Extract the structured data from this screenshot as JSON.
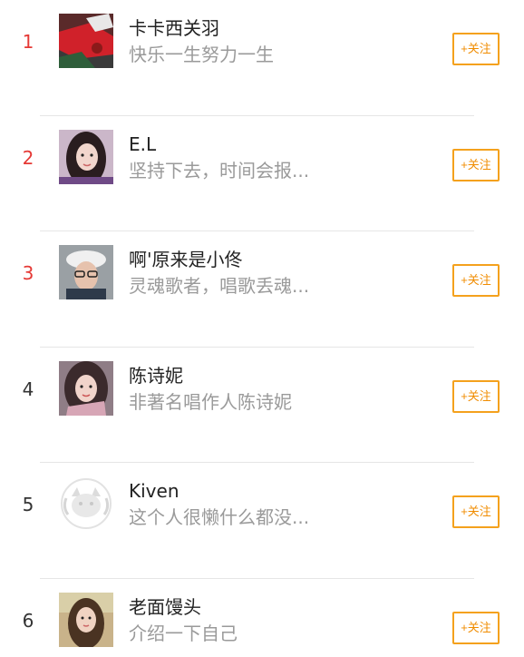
{
  "users": [
    {
      "rank": "1",
      "name": "卡卡西关羽",
      "desc": "快乐一生努力一生",
      "follow_label": "+关注",
      "avatar": "photo-red-icon"
    },
    {
      "rank": "2",
      "name": "E.L",
      "desc": "坚持下去，时间会报...",
      "follow_label": "+关注",
      "avatar": "photo-woman-icon"
    },
    {
      "rank": "3",
      "name": "啊'原来是小佟",
      "desc": "灵魂歌者，唱歌丢魂...",
      "follow_label": "+关注",
      "avatar": "photo-man-cap-icon"
    },
    {
      "rank": "4",
      "name": "陈诗妮",
      "desc": "非著名唱作人陈诗妮",
      "follow_label": "+关注",
      "avatar": "photo-woman-icon"
    },
    {
      "rank": "5",
      "name": "Kiven",
      "desc": "这个人很懒什么都没...",
      "follow_label": "+关注",
      "avatar": "default-avatar-icon"
    },
    {
      "rank": "6",
      "name": "老面馒头",
      "desc": "介绍一下自己",
      "follow_label": "+关注",
      "avatar": "photo-woman-icon"
    }
  ],
  "colors": {
    "rank_top": "#e53935",
    "rank_normal": "#333333",
    "follow_accent": "#f4a11d",
    "desc_gray": "#9a9a9a"
  }
}
